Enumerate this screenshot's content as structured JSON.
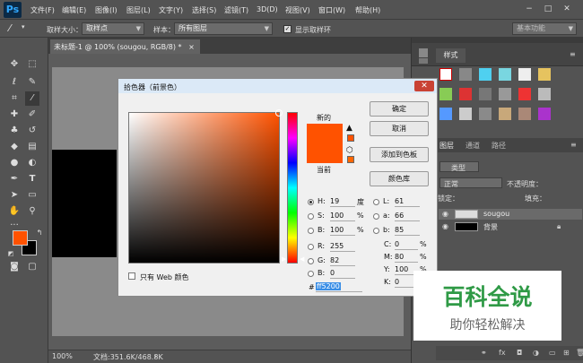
{
  "app": {
    "logo": "Ps"
  },
  "menu": [
    "文件(F)",
    "编辑(E)",
    "图像(I)",
    "图层(L)",
    "文字(Y)",
    "选择(S)",
    "滤镜(T)",
    "3D(D)",
    "视图(V)",
    "窗口(W)",
    "帮助(H)"
  ],
  "options": {
    "sample_size_label": "取样大小：",
    "sample_size_value": "取样点",
    "sample_label": "样本：",
    "sample_value": "所有图层",
    "show_ring_label": "显示取样环",
    "workspace": "基本功能"
  },
  "document": {
    "tab": "未标题-1 @ 100% (sougou, RGB/8) *",
    "zoom": "100%",
    "doc_info": "文档:351.6K/468.8K"
  },
  "colors": {
    "foreground": "#ff5200",
    "background": "#000000"
  },
  "dialog": {
    "title": "拾色器（前景色）",
    "new_label": "新的",
    "current_label": "当前",
    "buttons": {
      "ok": "确定",
      "cancel": "取消",
      "add_swatch": "添加到色板",
      "libraries": "颜色库"
    },
    "web_only": "只有 Web 颜色",
    "hsb": [
      {
        "label": "H:",
        "value": "19",
        "unit": "度"
      },
      {
        "label": "S:",
        "value": "100",
        "unit": "%"
      },
      {
        "label": "B:",
        "value": "100",
        "unit": "%"
      }
    ],
    "rgb": [
      {
        "label": "R:",
        "value": "255"
      },
      {
        "label": "G:",
        "value": "82"
      },
      {
        "label": "B:",
        "value": "0"
      }
    ],
    "lab": [
      {
        "label": "L:",
        "value": "61"
      },
      {
        "label": "a:",
        "value": "66"
      },
      {
        "label": "b:",
        "value": "85"
      }
    ],
    "cmyk": [
      {
        "label": "C:",
        "value": "0",
        "unit": "%"
      },
      {
        "label": "M:",
        "value": "80",
        "unit": "%"
      },
      {
        "label": "Y:",
        "value": "100",
        "unit": "%"
      },
      {
        "label": "K:",
        "value": "0",
        "unit": "%"
      }
    ],
    "hex_label": "#",
    "hex_value": "ff5200",
    "selected_color": "#ff5200"
  },
  "styles_panel": {
    "tab": "样式"
  },
  "layers_panel": {
    "tabs": [
      "图层",
      "通道",
      "路径"
    ],
    "kind_label": "类型",
    "blend": "正常",
    "opacity_label": "不透明度：",
    "lock_label": "锁定：",
    "fill_label": "填充：",
    "layers": [
      {
        "name": "sougou"
      },
      {
        "name": "背景"
      }
    ]
  },
  "watermark": {
    "title": "百科全说",
    "subtitle": "助你轻松解决"
  }
}
